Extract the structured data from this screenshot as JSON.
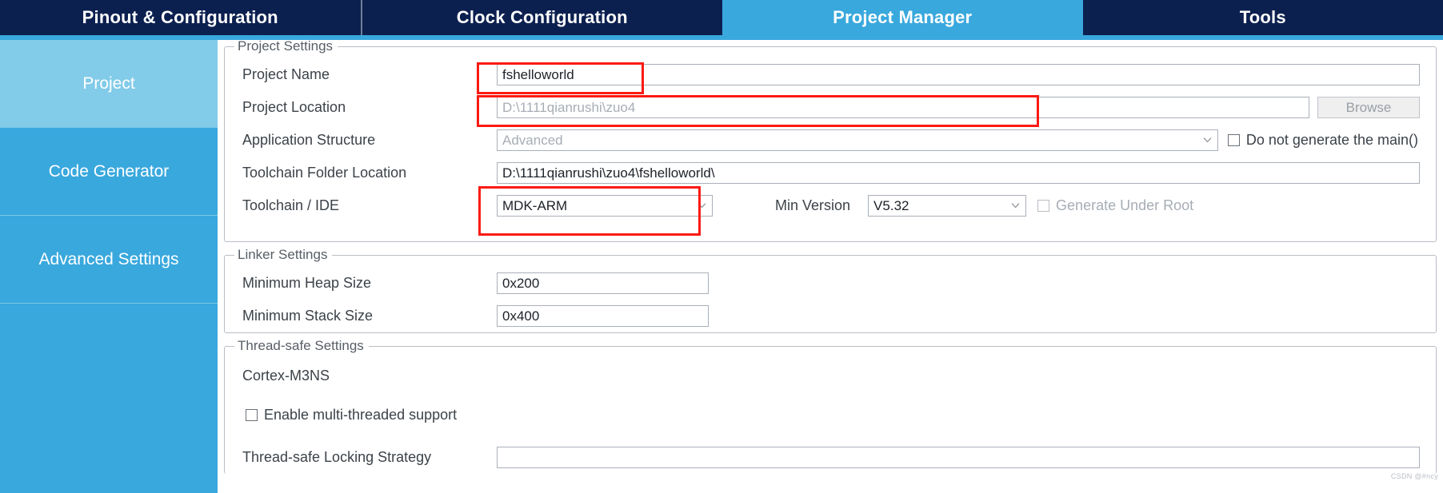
{
  "tabs": [
    {
      "label": "Pinout & Configuration",
      "active": false
    },
    {
      "label": "Clock Configuration",
      "active": false
    },
    {
      "label": "Project Manager",
      "active": true
    },
    {
      "label": "Tools",
      "active": false
    }
  ],
  "sidebar": {
    "items": [
      {
        "label": "Project",
        "active": true
      },
      {
        "label": "Code Generator",
        "active": false
      },
      {
        "label": "Advanced Settings",
        "active": false
      }
    ]
  },
  "project_settings": {
    "title": "Project Settings",
    "project_name": {
      "label": "Project Name",
      "value": "fshelloworld"
    },
    "project_location": {
      "label": "Project Location",
      "value": "D:\\1111qianrushi\\zuo4",
      "browse_label": "Browse"
    },
    "application_structure": {
      "label": "Application Structure",
      "value": "Advanced",
      "do_not_generate_main": "Do not generate the main()"
    },
    "toolchain_folder_location": {
      "label": "Toolchain Folder Location",
      "value": "D:\\1111qianrushi\\zuo4\\fshelloworld\\"
    },
    "toolchain_ide": {
      "label": "Toolchain / IDE",
      "value": "MDK-ARM",
      "min_version_label": "Min Version",
      "min_version_value": "V5.32",
      "generate_under_root": "Generate Under Root"
    }
  },
  "linker_settings": {
    "title": "Linker Settings",
    "min_heap": {
      "label": "Minimum Heap Size",
      "value": "0x200"
    },
    "min_stack": {
      "label": "Minimum Stack Size",
      "value": "0x400"
    }
  },
  "thread_safe_settings": {
    "title": "Thread-safe Settings",
    "core_label": "Cortex-M3NS",
    "enable_multithread": "Enable multi-threaded support",
    "partial_row_label": "Thread-safe Locking Strategy"
  },
  "watermark": "CSDN @#ncy",
  "colors": {
    "tab_bar": "#0c2050",
    "accent": "#39a8dd",
    "sidebar_active": "#82cbe9",
    "annotation": "#fb1a12"
  }
}
